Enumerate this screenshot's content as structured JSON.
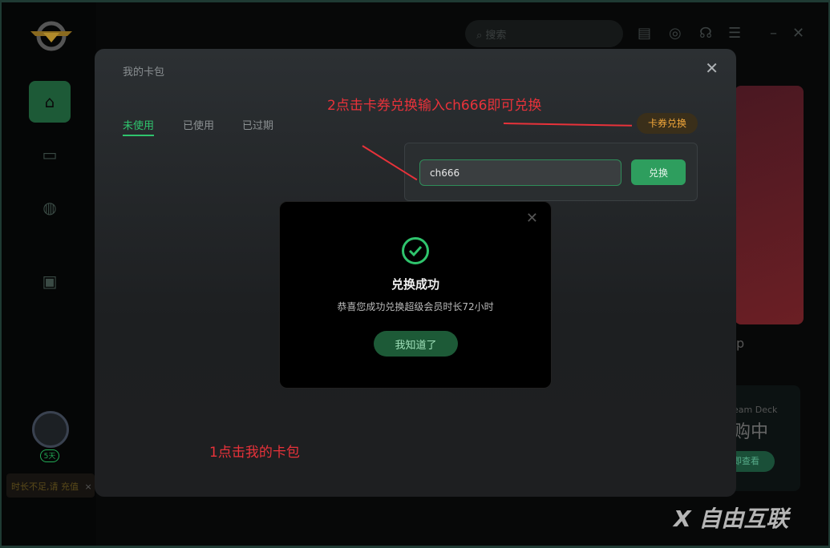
{
  "app": {
    "search_placeholder": "搜索",
    "nav": [
      "home",
      "monitor",
      "gamepad",
      "lock-bag"
    ],
    "avatar_badge": "5天",
    "tip_text": "时长不足,请 充值",
    "tip_close": "×",
    "promo_text": "p",
    "promo2_title": "eam Deck",
    "promo2_big": "购中",
    "promo2_btn": "即查看"
  },
  "modal": {
    "title": "我的卡包",
    "close": "✕",
    "tabs": [
      {
        "label": "未使用",
        "active": true
      },
      {
        "label": "已使用"
      },
      {
        "label": "已过期"
      }
    ],
    "redeem_button": "卡券兑换",
    "code_value": "ch666",
    "exchange_button": "兑换"
  },
  "success": {
    "title": "兑换成功",
    "message": "恭喜您成功兑换超级会员时长72小时",
    "ok_button": "我知道了",
    "close": "✕"
  },
  "annotations": {
    "step2": "2点击卡券兑换输入ch666即可兑换",
    "step1": "1点击我的卡包"
  },
  "watermark": "自由互联",
  "colors": {
    "accent": "#2fc46d",
    "annotation": "#e8323a",
    "redeem": "#f2a73a"
  }
}
